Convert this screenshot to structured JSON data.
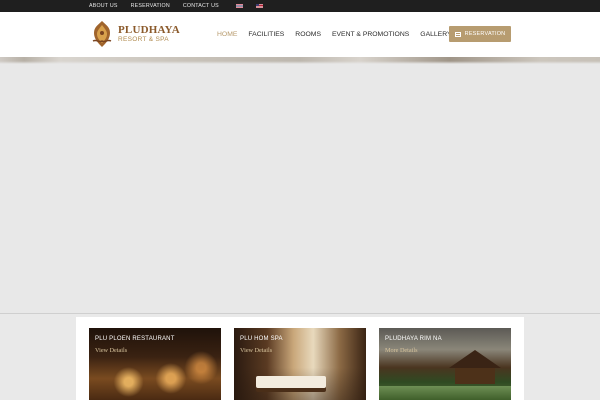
{
  "topbar": {
    "links": [
      "ABOUT US",
      "RESERVATION",
      "CONTACT US"
    ],
    "flags": [
      "flag-thai-icon",
      "flag-english-icon"
    ]
  },
  "header": {
    "logo_title": "PLUDHAYA",
    "logo_subtitle": "RESORT & SPA",
    "nav": [
      "HOME",
      "FACILITIES",
      "ROOMS",
      "EVENT & PROMOTIONS",
      "GALLERY"
    ],
    "active_nav": "HOME",
    "reserve_label": "RESERVATION"
  },
  "features": [
    {
      "title": "PLU PLOEN RESTAURANT",
      "link": "View Details"
    },
    {
      "title": "PLU HOM SPA",
      "link": "View Details"
    },
    {
      "title": "PLUDHAYA RIM NA",
      "link": "More Details"
    }
  ],
  "colors": {
    "accent": "#b79c70",
    "topbar_bg": "#1f1f1f",
    "link_gold": "#d7c39c"
  }
}
